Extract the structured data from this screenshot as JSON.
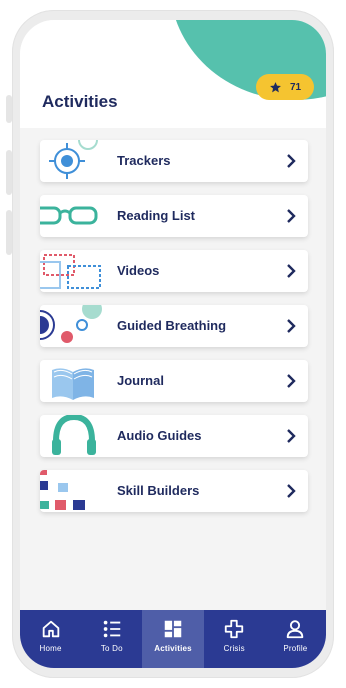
{
  "header": {
    "title": "Activities",
    "points": "71",
    "colors": {
      "teal": "#56c1ad",
      "badge": "#f5c430",
      "navy": "#1f2a5e"
    }
  },
  "activities": [
    {
      "label": "Trackers",
      "icon": "target-icon"
    },
    {
      "label": "Reading List",
      "icon": "glasses-icon"
    },
    {
      "label": "Videos",
      "icon": "video-frames-icon"
    },
    {
      "label": "Guided Breathing",
      "icon": "breathing-circles-icon"
    },
    {
      "label": "Journal",
      "icon": "open-book-icon"
    },
    {
      "label": "Audio Guides",
      "icon": "headphones-icon"
    },
    {
      "label": "Skill Builders",
      "icon": "blocks-icon"
    }
  ],
  "tabbar": {
    "items": [
      {
        "label": "Home",
        "icon": "home-icon",
        "active": false
      },
      {
        "label": "To Do",
        "icon": "list-icon",
        "active": false
      },
      {
        "label": "Activities",
        "icon": "grid-icon",
        "active": true
      },
      {
        "label": "Crisis",
        "icon": "cross-icon",
        "active": false
      },
      {
        "label": "Profile",
        "icon": "person-icon",
        "active": false
      }
    ],
    "color": "#2b3a93"
  }
}
